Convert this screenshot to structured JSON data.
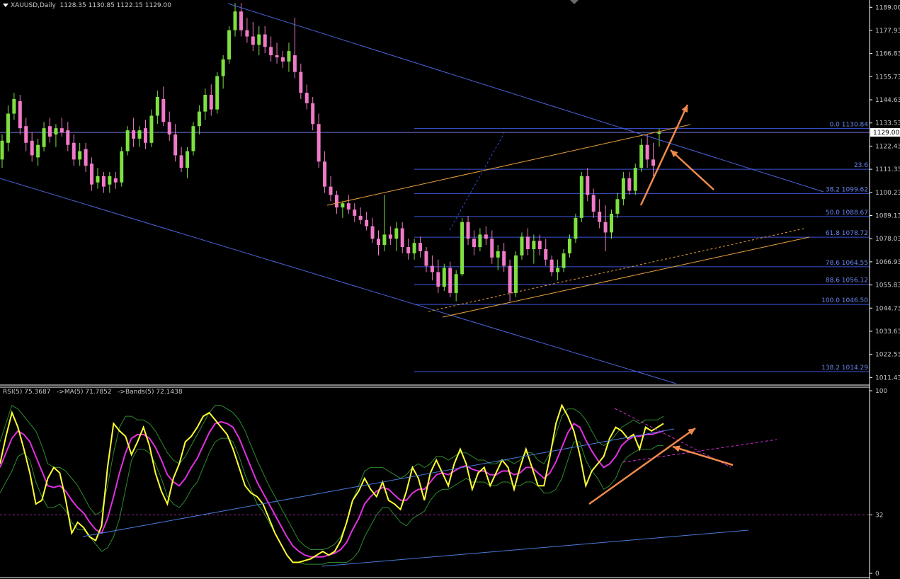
{
  "header": {
    "symbol": "XAUUSD,Daily",
    "ohlc": "1128.35 1130.85 1122.15 1129.00"
  },
  "rsi_header": "RSI(5) 75.3687   ->MA(5) 71.7852   ->Bands(5) 72.1438",
  "colors": {
    "background": "#000000",
    "bull_candle": "#7ee040",
    "bear_candle": "#f07ac8",
    "axis_line": "#ffffff",
    "axis_text": "#c8c8c8",
    "channel": "#4a63d8",
    "fib_level": "#3b55d8",
    "fib_text": "#6a86f0",
    "trendline_orange": "#e8a23a",
    "arrow": "#f08a4a",
    "rsi_line": "#ffff33",
    "rsi_ma": "#e030e0",
    "rsi_bands": "#2e8c2e"
  },
  "price_axis": {
    "ticks": [
      "1189.00",
      "1177.93",
      "1166.83",
      "1155.73",
      "1144.63",
      "1133.53",
      "1122.43",
      "1111.33",
      "1100.23",
      "1089.13",
      "1078.03",
      "1066.93",
      "1055.83",
      "1044.73",
      "1033.63",
      "1022.53",
      "1011.43"
    ],
    "current_price": "1129.00"
  },
  "fib_levels": [
    {
      "label": "0.0 1130.84",
      "value": 1130.84
    },
    {
      "label": "23.6",
      "value": 1111.33
    },
    {
      "label": "38.2 1099.62",
      "value": 1099.62
    },
    {
      "label": "50.0 1088.67",
      "value": 1088.67
    },
    {
      "label": "61.8 1078.72",
      "value": 1078.72
    },
    {
      "label": "78.6 1064.55",
      "value": 1064.55
    },
    {
      "label": "88.6 1056.12",
      "value": 1056.12
    },
    {
      "label": "100.0 1046.50",
      "value": 1046.5
    },
    {
      "label": "138.2 1014.29",
      "value": 1014.29
    }
  ],
  "rsi_axis": {
    "ticks": [
      "100",
      "32",
      "0"
    ],
    "level": 32
  },
  "chart_data": [
    {
      "type": "candlestick",
      "title": "XAUUSD,Daily",
      "ylim": [
        1008.5,
        1192.5
      ],
      "candles": [
        [
          1116,
          1128,
          1112,
          1125
        ],
        [
          1124,
          1142,
          1120,
          1138
        ],
        [
          1138,
          1148,
          1135,
          1145
        ],
        [
          1144,
          1147,
          1128,
          1131
        ],
        [
          1132,
          1136,
          1120,
          1124
        ],
        [
          1125,
          1129,
          1115,
          1118
        ],
        [
          1117,
          1126,
          1113,
          1123
        ],
        [
          1122,
          1134,
          1120,
          1131
        ],
        [
          1132,
          1136,
          1124,
          1127
        ],
        [
          1128,
          1133,
          1122,
          1131
        ],
        [
          1131,
          1136,
          1127,
          1129
        ],
        [
          1130,
          1134,
          1120,
          1123
        ],
        [
          1124,
          1128,
          1113,
          1116
        ],
        [
          1116,
          1124,
          1113,
          1120
        ],
        [
          1121,
          1124,
          1110,
          1113
        ],
        [
          1114,
          1117,
          1101,
          1104
        ],
        [
          1105,
          1112,
          1102,
          1108
        ],
        [
          1108,
          1110,
          1100,
          1103
        ],
        [
          1104,
          1110,
          1100,
          1108
        ],
        [
          1107,
          1110,
          1102,
          1105
        ],
        [
          1105,
          1122,
          1103,
          1120
        ],
        [
          1120,
          1132,
          1118,
          1130
        ],
        [
          1130,
          1136,
          1122,
          1126
        ],
        [
          1126,
          1132,
          1122,
          1130
        ],
        [
          1131,
          1135,
          1121,
          1124
        ],
        [
          1124,
          1140,
          1122,
          1137
        ],
        [
          1137,
          1149,
          1133,
          1146
        ],
        [
          1145,
          1151,
          1132,
          1134
        ],
        [
          1134,
          1139,
          1125,
          1128
        ],
        [
          1128,
          1133,
          1115,
          1118
        ],
        [
          1118,
          1122,
          1110,
          1112
        ],
        [
          1112,
          1122,
          1107,
          1120
        ],
        [
          1120,
          1134,
          1118,
          1132
        ],
        [
          1132,
          1142,
          1128,
          1139
        ],
        [
          1139,
          1150,
          1135,
          1147
        ],
        [
          1147,
          1152,
          1137,
          1140
        ],
        [
          1140,
          1158,
          1138,
          1156
        ],
        [
          1156,
          1166,
          1150,
          1164
        ],
        [
          1164,
          1180,
          1162,
          1178
        ],
        [
          1178,
          1191,
          1175,
          1187
        ],
        [
          1187,
          1191,
          1175,
          1178
        ],
        [
          1178,
          1184,
          1172,
          1175
        ],
        [
          1175,
          1182,
          1168,
          1171
        ],
        [
          1171,
          1180,
          1166,
          1176
        ],
        [
          1176,
          1180,
          1167,
          1170
        ],
        [
          1170,
          1175,
          1163,
          1166
        ],
        [
          1166,
          1172,
          1162,
          1165
        ],
        [
          1165,
          1168,
          1160,
          1163
        ],
        [
          1163,
          1172,
          1158,
          1168
        ],
        [
          1166,
          1184,
          1155,
          1158
        ],
        [
          1158,
          1162,
          1145,
          1148
        ],
        [
          1148,
          1152,
          1140,
          1143
        ],
        [
          1143,
          1146,
          1130,
          1133
        ],
        [
          1133,
          1138,
          1112,
          1115
        ],
        [
          1115,
          1120,
          1100,
          1103
        ],
        [
          1103,
          1108,
          1096,
          1099
        ],
        [
          1099,
          1101,
          1090,
          1093
        ],
        [
          1093,
          1096,
          1088,
          1095
        ],
        [
          1095,
          1099,
          1090,
          1092
        ],
        [
          1092,
          1095,
          1086,
          1089
        ],
        [
          1089,
          1093,
          1085,
          1087
        ],
        [
          1087,
          1091,
          1082,
          1084
        ],
        [
          1084,
          1088,
          1076,
          1078
        ],
        [
          1078,
          1082,
          1070,
          1075
        ],
        [
          1075,
          1099,
          1072,
          1080
        ],
        [
          1080,
          1084,
          1075,
          1078
        ],
        [
          1078,
          1086,
          1072,
          1083
        ],
        [
          1083,
          1086,
          1071,
          1074
        ],
        [
          1074,
          1078,
          1068,
          1071
        ],
        [
          1071,
          1078,
          1068,
          1076
        ],
        [
          1076,
          1079,
          1069,
          1072
        ],
        [
          1072,
          1074,
          1062,
          1065
        ],
        [
          1065,
          1070,
          1058,
          1062
        ],
        [
          1062,
          1068,
          1052,
          1055
        ],
        [
          1055,
          1066,
          1053,
          1064
        ],
        [
          1064,
          1067,
          1050,
          1052
        ],
        [
          1052,
          1063,
          1048,
          1061
        ],
        [
          1061,
          1088,
          1060,
          1086
        ],
        [
          1086,
          1089,
          1075,
          1078
        ],
        [
          1078,
          1082,
          1070,
          1074
        ],
        [
          1074,
          1083,
          1072,
          1080
        ],
        [
          1080,
          1084,
          1075,
          1078
        ],
        [
          1078,
          1082,
          1066,
          1069
        ],
        [
          1069,
          1075,
          1063,
          1072
        ],
        [
          1072,
          1076,
          1062,
          1065
        ],
        [
          1065,
          1068,
          1048,
          1052
        ],
        [
          1052,
          1072,
          1050,
          1070
        ],
        [
          1070,
          1081,
          1068,
          1079
        ],
        [
          1079,
          1083,
          1070,
          1073
        ],
        [
          1073,
          1080,
          1066,
          1077
        ],
        [
          1077,
          1080,
          1070,
          1073
        ],
        [
          1073,
          1078,
          1065,
          1068
        ],
        [
          1068,
          1070,
          1060,
          1062
        ],
        [
          1062,
          1068,
          1058,
          1064
        ],
        [
          1064,
          1073,
          1062,
          1071
        ],
        [
          1071,
          1080,
          1069,
          1078
        ],
        [
          1078,
          1090,
          1076,
          1088
        ],
        [
          1088,
          1110,
          1086,
          1108
        ],
        [
          1108,
          1112,
          1096,
          1099
        ],
        [
          1099,
          1102,
          1088,
          1091
        ],
        [
          1091,
          1097,
          1083,
          1086
        ],
        [
          1086,
          1094,
          1072,
          1081
        ],
        [
          1081,
          1092,
          1078,
          1090
        ],
        [
          1090,
          1100,
          1088,
          1097
        ],
        [
          1097,
          1110,
          1094,
          1107
        ],
        [
          1107,
          1110,
          1099,
          1101
        ],
        [
          1101,
          1114,
          1099,
          1112
        ],
        [
          1112,
          1126,
          1110,
          1123
        ],
        [
          1123,
          1128,
          1112,
          1116
        ],
        [
          1116,
          1124,
          1108,
          1113
        ],
        [
          1128.35,
          1130.85,
          1122.15,
          1129
        ]
      ]
    },
    {
      "type": "line",
      "title": "RSI(5) 75.3687   ->MA(5) 71.7852   ->Bands(5) 72.1438",
      "ylim": [
        0,
        100
      ],
      "series": [
        {
          "name": "RSI(5)",
          "values": [
            60,
            75,
            88,
            80,
            68,
            55,
            38,
            40,
            52,
            58,
            55,
            40,
            22,
            28,
            25,
            20,
            18,
            26,
            58,
            82,
            78,
            75,
            65,
            72,
            80,
            70,
            55,
            45,
            38,
            52,
            60,
            72,
            75,
            80,
            86,
            88,
            84,
            80,
            76,
            68,
            58,
            48,
            44,
            42,
            38,
            30,
            22,
            16,
            10,
            6,
            6,
            7,
            8,
            10,
            12,
            10,
            12,
            18,
            28,
            40,
            45,
            52,
            46,
            42,
            50,
            40,
            38,
            35,
            45,
            58,
            52,
            40,
            55,
            62,
            55,
            48,
            60,
            68,
            60,
            46,
            55,
            58,
            48,
            55,
            62,
            58,
            46,
            58,
            68,
            58,
            48,
            48,
            64,
            82,
            92,
            86,
            78,
            65,
            48,
            56,
            60,
            64,
            74,
            80,
            78,
            74,
            76,
            68,
            80,
            78,
            80,
            82
          ]
        },
        {
          "name": "MA(5)",
          "values": [
            58,
            66,
            74,
            78,
            76,
            72,
            64,
            56,
            48,
            47,
            48,
            45,
            40,
            36,
            33,
            28,
            24,
            22,
            30,
            42,
            55,
            66,
            74,
            76,
            76,
            74,
            69,
            62,
            54,
            50,
            48,
            52,
            58,
            63,
            70,
            77,
            82,
            83,
            82,
            80,
            74,
            66,
            58,
            50,
            44,
            38,
            32,
            26,
            20,
            15,
            12,
            10,
            9,
            9,
            9,
            10,
            11,
            13,
            17,
            24,
            30,
            38,
            42,
            45,
            47,
            46,
            43,
            40,
            40,
            44,
            46,
            46,
            50,
            54,
            55,
            54,
            56,
            58,
            59,
            57,
            56,
            56,
            54,
            54,
            56,
            56,
            54,
            55,
            58,
            58,
            55,
            52,
            55,
            61,
            69,
            77,
            82,
            80,
            73,
            67,
            62,
            58,
            60,
            64,
            70,
            73,
            75,
            75,
            76,
            76,
            77,
            78
          ]
        },
        {
          "name": "Bands(5) upper",
          "values": [
            72,
            82,
            92,
            90,
            86,
            82,
            78,
            70,
            60,
            58,
            58,
            56,
            52,
            48,
            42,
            36,
            32,
            34,
            48,
            66,
            80,
            86,
            86,
            84,
            84,
            82,
            78,
            72,
            66,
            62,
            60,
            64,
            70,
            76,
            82,
            88,
            92,
            92,
            90,
            88,
            84,
            78,
            70,
            62,
            55,
            48,
            42,
            36,
            30,
            24,
            18,
            15,
            13,
            13,
            13,
            14,
            16,
            20,
            28,
            40,
            48,
            56,
            58,
            58,
            58,
            56,
            54,
            52,
            54,
            58,
            60,
            58,
            60,
            64,
            64,
            62,
            64,
            66,
            66,
            64,
            62,
            62,
            60,
            60,
            62,
            62,
            60,
            62,
            66,
            66,
            62,
            60,
            66,
            76,
            86,
            90,
            90,
            88,
            84,
            78,
            72,
            70,
            72,
            76,
            80,
            82,
            84,
            82,
            84,
            84,
            84,
            86
          ]
        },
        {
          "name": "Bands(5) lower",
          "values": [
            44,
            50,
            56,
            64,
            66,
            62,
            50,
            42,
            36,
            36,
            38,
            34,
            28,
            24,
            24,
            20,
            16,
            12,
            14,
            20,
            30,
            46,
            62,
            68,
            68,
            66,
            60,
            52,
            42,
            38,
            36,
            40,
            46,
            50,
            58,
            66,
            72,
            74,
            74,
            72,
            64,
            54,
            46,
            38,
            34,
            28,
            22,
            16,
            10,
            6,
            6,
            5,
            5,
            5,
            5,
            6,
            6,
            6,
            6,
            8,
            12,
            20,
            26,
            32,
            36,
            36,
            32,
            28,
            26,
            30,
            32,
            34,
            40,
            44,
            46,
            46,
            48,
            50,
            52,
            50,
            50,
            50,
            48,
            48,
            50,
            50,
            48,
            48,
            50,
            50,
            48,
            44,
            44,
            46,
            52,
            62,
            72,
            72,
            62,
            56,
            52,
            46,
            48,
            52,
            60,
            64,
            66,
            68,
            68,
            68,
            70,
            70
          ]
        }
      ]
    }
  ]
}
